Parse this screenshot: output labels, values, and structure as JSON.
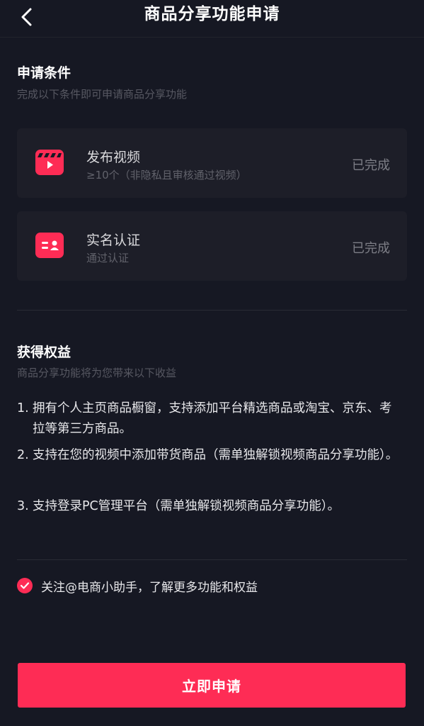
{
  "header": {
    "title": "商品分享功能申请"
  },
  "conditions": {
    "title": "申请条件",
    "subtitle": "完成以下条件即可申请商品分享功能",
    "items": [
      {
        "icon": "video-clapper-icon",
        "title": "发布视频",
        "desc": "≥10个（非隐私且审核通过视频）",
        "status": "已完成"
      },
      {
        "icon": "id-card-icon",
        "title": "实名认证",
        "desc": "通过认证",
        "status": "已完成"
      }
    ]
  },
  "benefits": {
    "title": "获得权益",
    "subtitle": "商品分享功能将为您带来以下收益",
    "items": [
      {
        "num": "1.",
        "text": "拥有个人主页商品橱窗，支持添加平台精选商品或淘宝、京东、考拉等第三方商品。"
      },
      {
        "num": "2.",
        "text": "支持在您的视频中添加带货商品（需单独解锁视频商品分享功能）。"
      },
      {
        "num": "3.",
        "text": "支持登录PC管理平台（需单独解锁视频商品分享功能）。"
      }
    ]
  },
  "follow": {
    "checked": true,
    "label": "关注@电商小助手，了解更多功能和权益"
  },
  "apply_button": {
    "label": "立即申请"
  },
  "colors": {
    "background": "#161823",
    "accent": "#fe2c55",
    "card": "#1d1e28"
  }
}
